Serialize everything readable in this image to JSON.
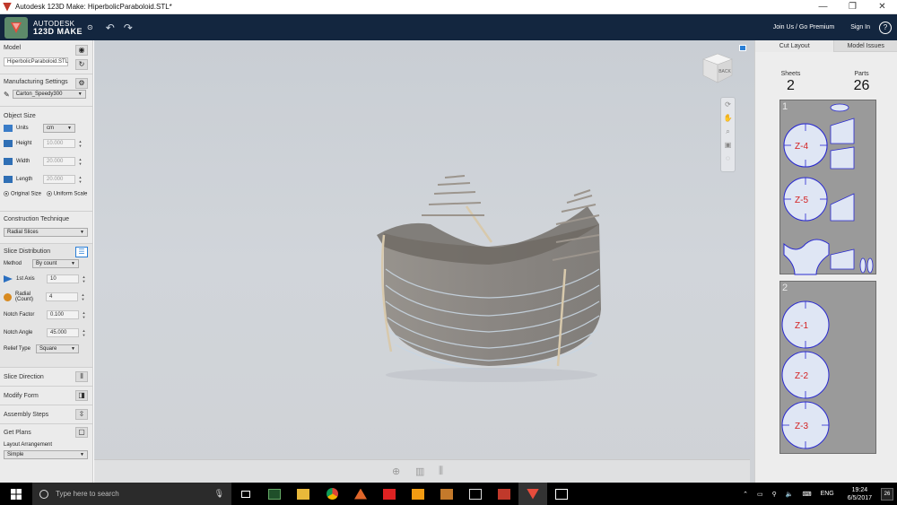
{
  "window": {
    "title": "Autodesk 123D Make: HiperbolicParaboloid.STL*",
    "controls": [
      "—",
      "❐",
      "✕"
    ]
  },
  "appbar": {
    "brand_line1": "AUTODESK",
    "brand_line2": "123D MAKE",
    "premium_link": "Join Us / Go Premium",
    "signin_link": "Sign In",
    "help": "?"
  },
  "left": {
    "model": {
      "title": "Model",
      "file": "HiperbolicParaboloid.STL"
    },
    "manufacturing": {
      "title": "Manufacturing Settings",
      "value": "Carton_Speedy300"
    },
    "object_size": {
      "title": "Object Size",
      "units_label": "Units",
      "units_value": "cm",
      "height_label": "Height",
      "height_value": "10.000",
      "width_label": "Width",
      "width_value": "20.000",
      "length_label": "Length",
      "length_value": "20.000",
      "original_size": "Original Size",
      "uniform_scale": "Uniform Scale"
    },
    "construction": {
      "title": "Construction Technique",
      "value": "Radial Slices"
    },
    "slice_distribution": {
      "title": "Slice Distribution",
      "method_label": "Method",
      "method_value": "By count",
      "axis1_label": "1st Axis",
      "axis1_value": "10",
      "radial_label": "Radial",
      "radial_sub": "(Count)",
      "radial_value": "4",
      "notch_factor_label": "Notch Factor",
      "notch_factor_value": "0.100",
      "notch_angle_label": "Notch Angle",
      "notch_angle_value": "45.000",
      "relief_label": "Relief Type",
      "relief_value": "Square"
    },
    "slice_direction": "Slice Direction",
    "modify_form": "Modify Form",
    "assembly_steps": "Assembly Steps",
    "get_plans": {
      "title": "Get Plans",
      "layout_label": "Layout Arrangement",
      "layout_value": "Simple"
    }
  },
  "viewport": {
    "cube_face": "BACK"
  },
  "right": {
    "tabs": [
      "Cut Layout",
      "Model Issues"
    ],
    "sheets_label": "Sheets",
    "sheets_value": "2",
    "parts_label": "Parts",
    "parts_value": "26",
    "sheet1": {
      "number": "1",
      "labels": [
        "Z-4",
        "Z-5"
      ]
    },
    "sheet2": {
      "number": "2",
      "labels": [
        "Z-1",
        "Z-2",
        "Z-3"
      ]
    }
  },
  "taskbar": {
    "search_placeholder": "Type here to search",
    "lang": "ENG",
    "time": "19:24",
    "date": "6/5/2017",
    "notifications": "26"
  },
  "colors": {
    "appbar": "#13263f",
    "part_outline": "#2a2ad0",
    "part_label": "#d42020",
    "accent": "#2a7fd6"
  }
}
